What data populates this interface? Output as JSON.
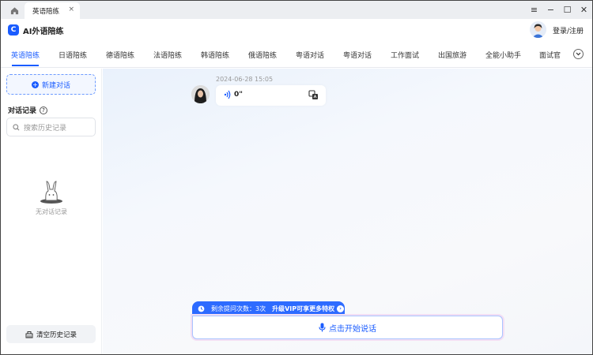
{
  "window": {
    "tab_title": "英语陪练",
    "tab_close": "×",
    "controls": {
      "menu": "≡",
      "minimize": "−",
      "maximize": "☐",
      "close": "✕"
    }
  },
  "header": {
    "app_title": "AI外语陪练",
    "login_label": "登录/注册"
  },
  "nav": {
    "items": [
      {
        "label": "英语陪练",
        "active": true
      },
      {
        "label": "日语陪练"
      },
      {
        "label": "德语陪练"
      },
      {
        "label": "法语陪练"
      },
      {
        "label": "韩语陪练"
      },
      {
        "label": "俄语陪练"
      },
      {
        "label": "粤语对话"
      },
      {
        "label": "粤语对话"
      },
      {
        "label": "工作面试"
      },
      {
        "label": "出国旅游"
      },
      {
        "label": "全能小助手"
      },
      {
        "label": "面试官"
      }
    ]
  },
  "sidebar": {
    "new_chat_label": "新建对话",
    "history_title": "对话记录",
    "search_placeholder": "搜索历史记录",
    "empty_text": "无对话记录",
    "clear_label": "清空历史记录"
  },
  "chat": {
    "timestamp": "2024-06-28 15:05",
    "message_duration": "0\""
  },
  "footer": {
    "quota_text": "剩余提问次数：3次",
    "upgrade_text": "升级VIP可享更多特权",
    "speak_label": "点击开始说话"
  },
  "colors": {
    "accent": "#1a5cff"
  }
}
